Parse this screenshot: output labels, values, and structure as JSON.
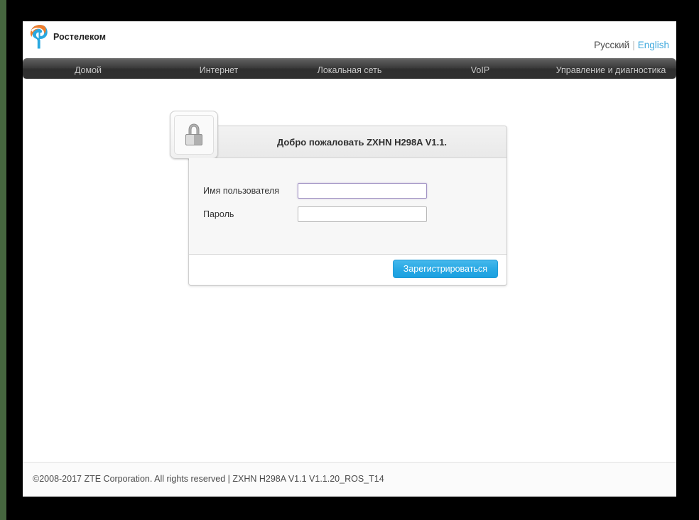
{
  "brand": {
    "name": "Ростелеком",
    "logo_colors": {
      "orange": "#f07d2b",
      "blue": "#29a8e0"
    }
  },
  "language": {
    "russian": "Русский",
    "separator": "|",
    "english": "English",
    "active": "Русский"
  },
  "nav": {
    "items": [
      {
        "label": "Домой"
      },
      {
        "label": "Интернет"
      },
      {
        "label": "Локальная сеть"
      },
      {
        "label": "VoIP"
      },
      {
        "label": "Управление и диагностика"
      }
    ]
  },
  "login": {
    "title": "Добро пожаловать ZXHN H298A V1.1.",
    "icon": "lock-icon",
    "username": {
      "label": "Имя пользователя",
      "value": "",
      "placeholder": ""
    },
    "password": {
      "label": "Пароль",
      "value": "",
      "placeholder": ""
    },
    "submit_label": "Зарегистрироваться",
    "accent_color": "#27a8e4"
  },
  "footer": {
    "text": "©2008-2017 ZTE Corporation. All rights reserved  |   ZXHN H298A V1.1 V1.1.20_ROS_T14"
  }
}
